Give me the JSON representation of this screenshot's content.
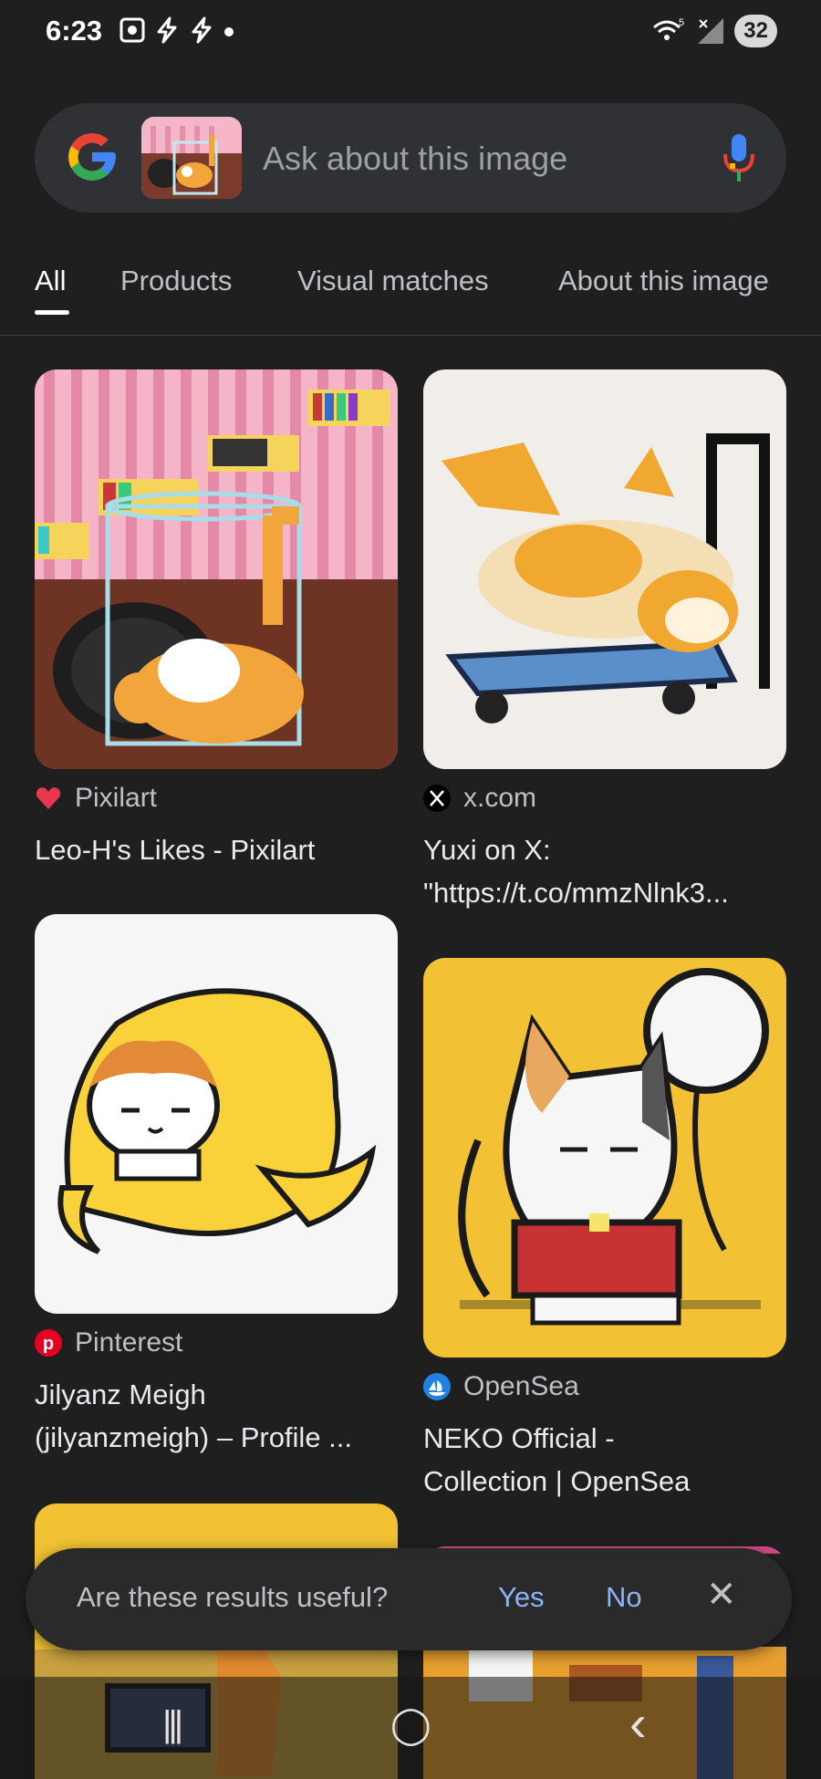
{
  "status_bar": {
    "time": "6:23",
    "left_icons": [
      "screenshot-icon",
      "flash-icon",
      "flash-icon",
      "dot-icon"
    ],
    "wifi_label": "5",
    "battery": "32"
  },
  "search": {
    "placeholder": "Ask about this image"
  },
  "tabs": [
    {
      "label": "All",
      "active": true
    },
    {
      "label": "Products",
      "active": false
    },
    {
      "label": "Visual matches",
      "active": false
    },
    {
      "label": "About this image",
      "active": false
    }
  ],
  "results": [
    {
      "source": "Pixilart",
      "title": "Leo-H's Likes - Pixilart",
      "title_line2": "",
      "icon": "heart-icon",
      "icon_color": "#e8384f"
    },
    {
      "source": "x.com",
      "title": "Yuxi on X:",
      "title_line2": "\"https://t.co/mmzNlnk3...",
      "icon": "x-logo-icon",
      "icon_color": "#000000"
    },
    {
      "source": "Pinterest",
      "title": "Jilyanz Meigh",
      "title_line2": "(jilyanzmeigh) – Profile ...",
      "icon": "pinterest-icon",
      "icon_color": "#e60023"
    },
    {
      "source": "OpenSea",
      "title": "NEKO Official -",
      "title_line2": "Collection | OpenSea",
      "icon": "opensea-icon",
      "icon_color": "#2081e2"
    }
  ],
  "feedback": {
    "question": "Are these results useful?",
    "yes": "Yes",
    "no": "No",
    "close": "✕"
  },
  "nav_bar": {
    "recents": "|||",
    "home": "◯",
    "back": "‹"
  },
  "colors": {
    "background": "#1f1f1f",
    "search_bg": "#303134",
    "accent_blue": "#8ab4f8"
  }
}
